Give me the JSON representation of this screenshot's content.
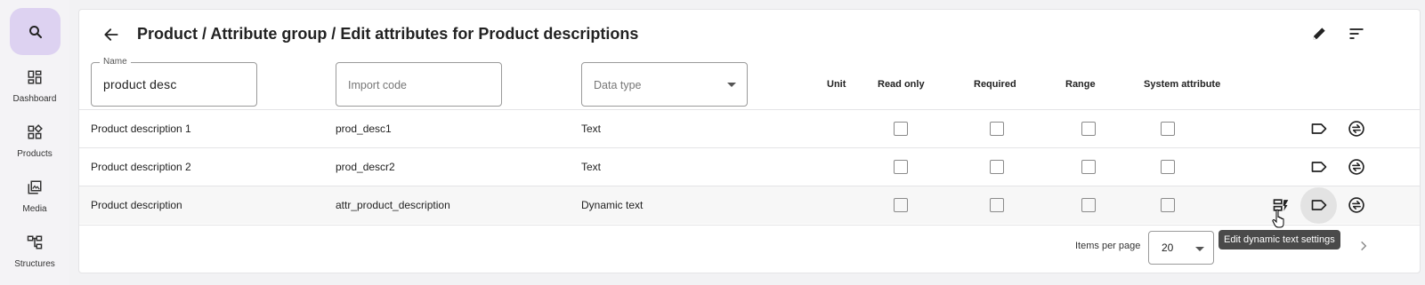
{
  "sidebar": {
    "items": [
      {
        "label": "Dashboard",
        "icon": "dashboard-icon"
      },
      {
        "label": "Products",
        "icon": "products-icon"
      },
      {
        "label": "Media",
        "icon": "media-icon"
      },
      {
        "label": "Structures",
        "icon": "structures-icon"
      }
    ],
    "accent": "#ddd2f1"
  },
  "header": {
    "title": "Product / Attribute group / Edit attributes for Product descriptions"
  },
  "filters": {
    "name_label": "Name",
    "name_value": "product desc",
    "import_code_placeholder": "Import code",
    "data_type_placeholder": "Data type"
  },
  "columns": {
    "unit": "Unit",
    "read_only": "Read only",
    "required": "Required",
    "range": "Range",
    "system_attribute": "System attribute"
  },
  "rows": [
    {
      "name": "Product description 1",
      "import_code": "prod_desc1",
      "data_type": "Text"
    },
    {
      "name": "Product description 2",
      "import_code": "prod_descr2",
      "data_type": "Text"
    },
    {
      "name": "Product description",
      "import_code": "attr_product_description",
      "data_type": "Dynamic text"
    }
  ],
  "footer": {
    "items_per_page_label": "Items per page",
    "items_per_page_value": "20"
  },
  "tooltip": "Edit dynamic text settings"
}
